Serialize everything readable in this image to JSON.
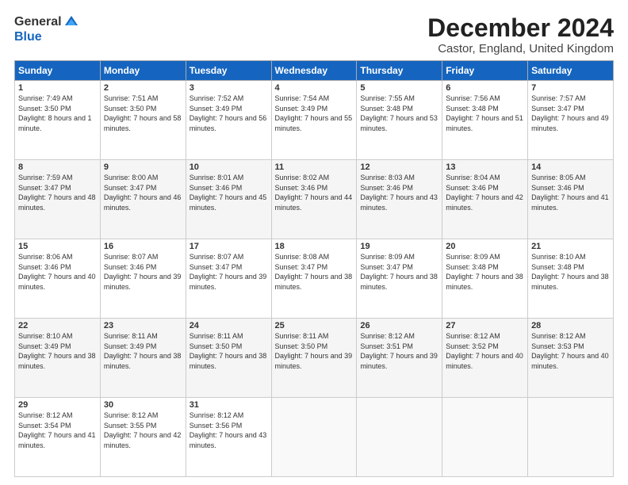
{
  "logo": {
    "general": "General",
    "blue": "Blue"
  },
  "title": "December 2024",
  "location": "Castor, England, United Kingdom",
  "headers": [
    "Sunday",
    "Monday",
    "Tuesday",
    "Wednesday",
    "Thursday",
    "Friday",
    "Saturday"
  ],
  "weeks": [
    [
      {
        "day": "1",
        "sunrise": "Sunrise: 7:49 AM",
        "sunset": "Sunset: 3:50 PM",
        "daylight": "Daylight: 8 hours and 1 minute."
      },
      {
        "day": "2",
        "sunrise": "Sunrise: 7:51 AM",
        "sunset": "Sunset: 3:50 PM",
        "daylight": "Daylight: 7 hours and 58 minutes."
      },
      {
        "day": "3",
        "sunrise": "Sunrise: 7:52 AM",
        "sunset": "Sunset: 3:49 PM",
        "daylight": "Daylight: 7 hours and 56 minutes."
      },
      {
        "day": "4",
        "sunrise": "Sunrise: 7:54 AM",
        "sunset": "Sunset: 3:49 PM",
        "daylight": "Daylight: 7 hours and 55 minutes."
      },
      {
        "day": "5",
        "sunrise": "Sunrise: 7:55 AM",
        "sunset": "Sunset: 3:48 PM",
        "daylight": "Daylight: 7 hours and 53 minutes."
      },
      {
        "day": "6",
        "sunrise": "Sunrise: 7:56 AM",
        "sunset": "Sunset: 3:48 PM",
        "daylight": "Daylight: 7 hours and 51 minutes."
      },
      {
        "day": "7",
        "sunrise": "Sunrise: 7:57 AM",
        "sunset": "Sunset: 3:47 PM",
        "daylight": "Daylight: 7 hours and 49 minutes."
      }
    ],
    [
      {
        "day": "8",
        "sunrise": "Sunrise: 7:59 AM",
        "sunset": "Sunset: 3:47 PM",
        "daylight": "Daylight: 7 hours and 48 minutes."
      },
      {
        "day": "9",
        "sunrise": "Sunrise: 8:00 AM",
        "sunset": "Sunset: 3:47 PM",
        "daylight": "Daylight: 7 hours and 46 minutes."
      },
      {
        "day": "10",
        "sunrise": "Sunrise: 8:01 AM",
        "sunset": "Sunset: 3:46 PM",
        "daylight": "Daylight: 7 hours and 45 minutes."
      },
      {
        "day": "11",
        "sunrise": "Sunrise: 8:02 AM",
        "sunset": "Sunset: 3:46 PM",
        "daylight": "Daylight: 7 hours and 44 minutes."
      },
      {
        "day": "12",
        "sunrise": "Sunrise: 8:03 AM",
        "sunset": "Sunset: 3:46 PM",
        "daylight": "Daylight: 7 hours and 43 minutes."
      },
      {
        "day": "13",
        "sunrise": "Sunrise: 8:04 AM",
        "sunset": "Sunset: 3:46 PM",
        "daylight": "Daylight: 7 hours and 42 minutes."
      },
      {
        "day": "14",
        "sunrise": "Sunrise: 8:05 AM",
        "sunset": "Sunset: 3:46 PM",
        "daylight": "Daylight: 7 hours and 41 minutes."
      }
    ],
    [
      {
        "day": "15",
        "sunrise": "Sunrise: 8:06 AM",
        "sunset": "Sunset: 3:46 PM",
        "daylight": "Daylight: 7 hours and 40 minutes."
      },
      {
        "day": "16",
        "sunrise": "Sunrise: 8:07 AM",
        "sunset": "Sunset: 3:46 PM",
        "daylight": "Daylight: 7 hours and 39 minutes."
      },
      {
        "day": "17",
        "sunrise": "Sunrise: 8:07 AM",
        "sunset": "Sunset: 3:47 PM",
        "daylight": "Daylight: 7 hours and 39 minutes."
      },
      {
        "day": "18",
        "sunrise": "Sunrise: 8:08 AM",
        "sunset": "Sunset: 3:47 PM",
        "daylight": "Daylight: 7 hours and 38 minutes."
      },
      {
        "day": "19",
        "sunrise": "Sunrise: 8:09 AM",
        "sunset": "Sunset: 3:47 PM",
        "daylight": "Daylight: 7 hours and 38 minutes."
      },
      {
        "day": "20",
        "sunrise": "Sunrise: 8:09 AM",
        "sunset": "Sunset: 3:48 PM",
        "daylight": "Daylight: 7 hours and 38 minutes."
      },
      {
        "day": "21",
        "sunrise": "Sunrise: 8:10 AM",
        "sunset": "Sunset: 3:48 PM",
        "daylight": "Daylight: 7 hours and 38 minutes."
      }
    ],
    [
      {
        "day": "22",
        "sunrise": "Sunrise: 8:10 AM",
        "sunset": "Sunset: 3:49 PM",
        "daylight": "Daylight: 7 hours and 38 minutes."
      },
      {
        "day": "23",
        "sunrise": "Sunrise: 8:11 AM",
        "sunset": "Sunset: 3:49 PM",
        "daylight": "Daylight: 7 hours and 38 minutes."
      },
      {
        "day": "24",
        "sunrise": "Sunrise: 8:11 AM",
        "sunset": "Sunset: 3:50 PM",
        "daylight": "Daylight: 7 hours and 38 minutes."
      },
      {
        "day": "25",
        "sunrise": "Sunrise: 8:11 AM",
        "sunset": "Sunset: 3:50 PM",
        "daylight": "Daylight: 7 hours and 39 minutes."
      },
      {
        "day": "26",
        "sunrise": "Sunrise: 8:12 AM",
        "sunset": "Sunset: 3:51 PM",
        "daylight": "Daylight: 7 hours and 39 minutes."
      },
      {
        "day": "27",
        "sunrise": "Sunrise: 8:12 AM",
        "sunset": "Sunset: 3:52 PM",
        "daylight": "Daylight: 7 hours and 40 minutes."
      },
      {
        "day": "28",
        "sunrise": "Sunrise: 8:12 AM",
        "sunset": "Sunset: 3:53 PM",
        "daylight": "Daylight: 7 hours and 40 minutes."
      }
    ],
    [
      {
        "day": "29",
        "sunrise": "Sunrise: 8:12 AM",
        "sunset": "Sunset: 3:54 PM",
        "daylight": "Daylight: 7 hours and 41 minutes."
      },
      {
        "day": "30",
        "sunrise": "Sunrise: 8:12 AM",
        "sunset": "Sunset: 3:55 PM",
        "daylight": "Daylight: 7 hours and 42 minutes."
      },
      {
        "day": "31",
        "sunrise": "Sunrise: 8:12 AM",
        "sunset": "Sunset: 3:56 PM",
        "daylight": "Daylight: 7 hours and 43 minutes."
      },
      null,
      null,
      null,
      null
    ]
  ]
}
